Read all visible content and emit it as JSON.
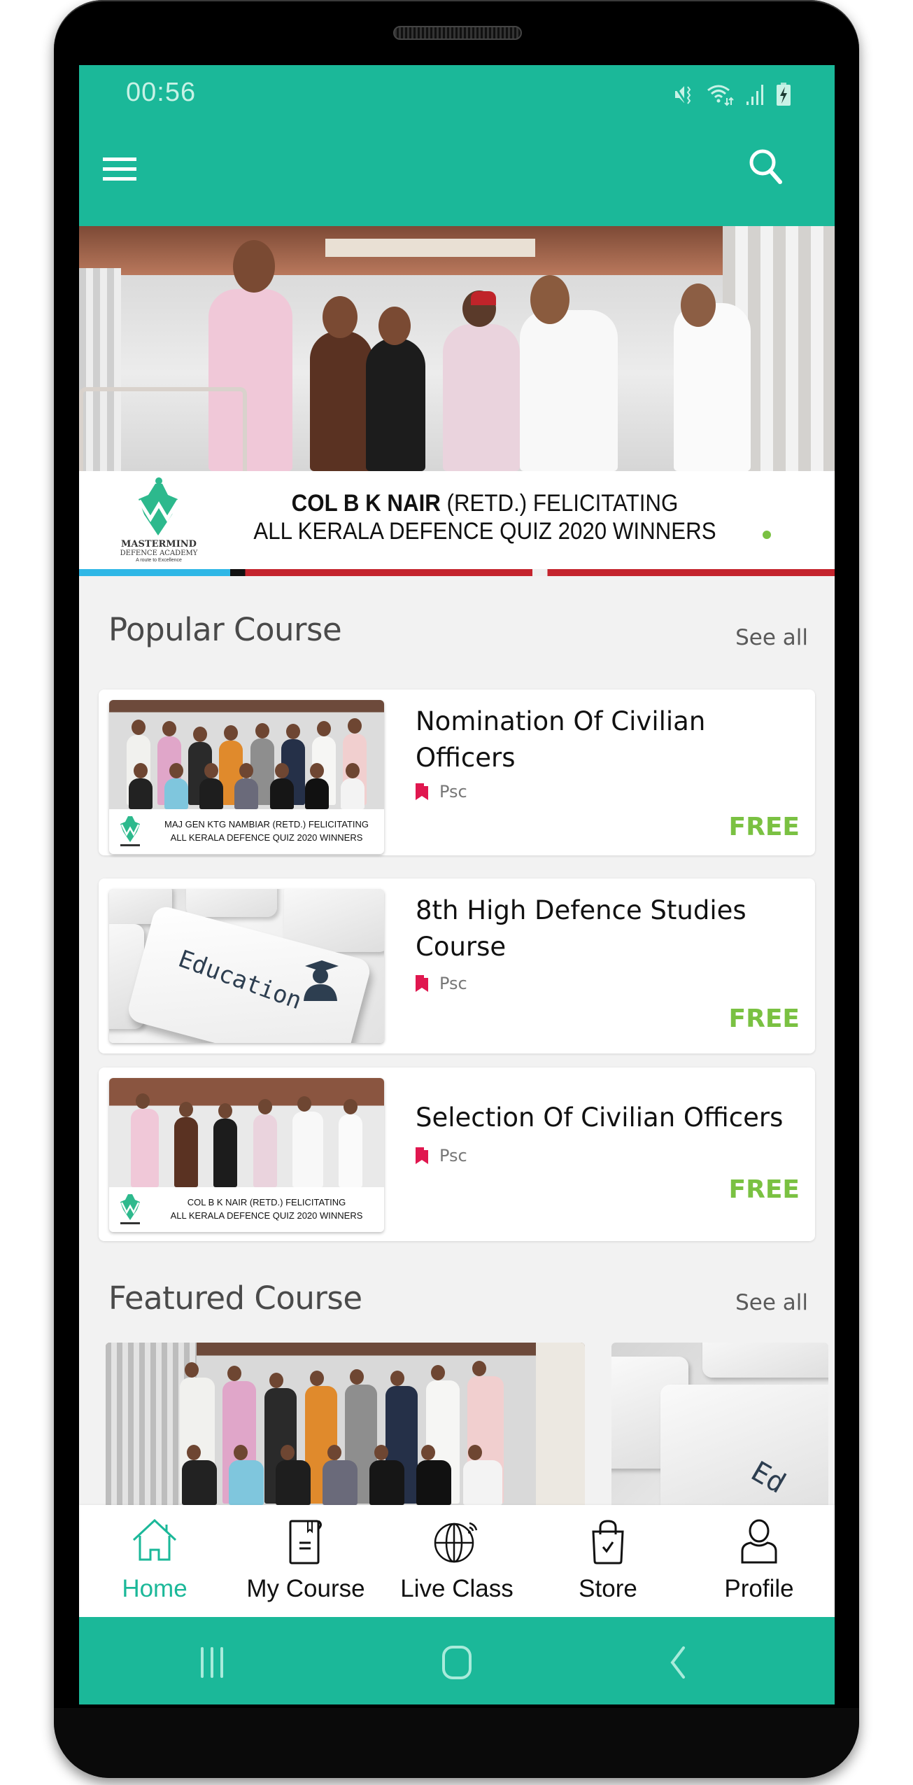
{
  "status_bar": {
    "time": "00:56",
    "icons": [
      "vibrate-mute-icon",
      "wifi-icon",
      "signal-icon",
      "battery-charging-icon"
    ]
  },
  "toolbar": {
    "menu_icon": "hamburger-menu-icon",
    "search_icon": "search-icon"
  },
  "banner": {
    "logo_name": "MASTERMIND",
    "logo_sub": "DEFENCE ACADEMY",
    "logo_tagline": "A route to Excellence",
    "caption_bold": "COL B K NAIR",
    "caption_rest_line1": " (RETD.) FELICITATING",
    "caption_line2": "ALL KERALA DEFENCE QUIZ 2020  WINNERS",
    "active_slide_color": "#7ac142"
  },
  "popular": {
    "title": "Popular Course",
    "see_all": "See all",
    "courses": [
      {
        "title": "Nomination Of Civilian Officers",
        "category": "Psc",
        "price": "FREE",
        "thumb_caption_line1": "MAJ GEN KTG NAMBIAR (RETD.) FELICITATING",
        "thumb_caption_line2": "ALL KERALA DEFENCE QUIZ 2020  WINNERS"
      },
      {
        "title": "8th High Defence Studies Course",
        "category": "Psc",
        "price": "FREE",
        "thumb_word": "Education"
      },
      {
        "title": "Selection Of Civilian Officers",
        "category": "Psc",
        "price": "FREE",
        "thumb_caption_line1": "COL B K NAIR (RETD.) FELICITATING",
        "thumb_caption_line2": "ALL KERALA DEFENCE QUIZ 2020  WINNERS"
      }
    ]
  },
  "featured": {
    "title": "Featured Course",
    "see_all": "See all",
    "partial_word": "Ed"
  },
  "bottom_nav": {
    "items": [
      {
        "label": "Home",
        "icon": "home-icon",
        "active": true
      },
      {
        "label": "My Course",
        "icon": "book-icon",
        "active": false
      },
      {
        "label": "Live Class",
        "icon": "globe-broadcast-icon",
        "active": false
      },
      {
        "label": "Store",
        "icon": "shopping-bag-icon",
        "active": false
      },
      {
        "label": "Profile",
        "icon": "user-icon",
        "active": false
      }
    ]
  },
  "system_nav": {
    "buttons": [
      "recent-apps-icon",
      "home-circle-icon",
      "back-icon"
    ]
  },
  "colors": {
    "primary": "#1bb899",
    "price": "#7ac142",
    "category_icon": "#e0174f",
    "background": "#f2f2f2"
  }
}
